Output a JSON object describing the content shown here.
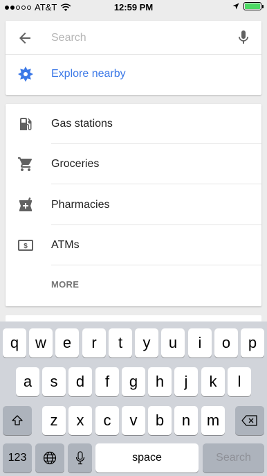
{
  "status_bar": {
    "carrier": "AT&T",
    "time": "12:59 PM"
  },
  "search": {
    "placeholder": "Search"
  },
  "explore": {
    "label": "Explore nearby",
    "color": "#3b78e7"
  },
  "categories": [
    {
      "icon": "gas-station-icon",
      "label": "Gas stations"
    },
    {
      "icon": "cart-icon",
      "label": "Groceries"
    },
    {
      "icon": "pharmacy-icon",
      "label": "Pharmacies"
    },
    {
      "icon": "atm-icon",
      "label": "ATMs"
    }
  ],
  "more_label": "MORE",
  "keyboard": {
    "row1": [
      "q",
      "w",
      "e",
      "r",
      "t",
      "y",
      "u",
      "i",
      "o",
      "p"
    ],
    "row2": [
      "a",
      "s",
      "d",
      "f",
      "g",
      "h",
      "j",
      "k",
      "l"
    ],
    "row3": [
      "z",
      "x",
      "c",
      "v",
      "b",
      "n",
      "m"
    ],
    "numbers_label": "123",
    "space_label": "space",
    "search_label": "Search"
  }
}
